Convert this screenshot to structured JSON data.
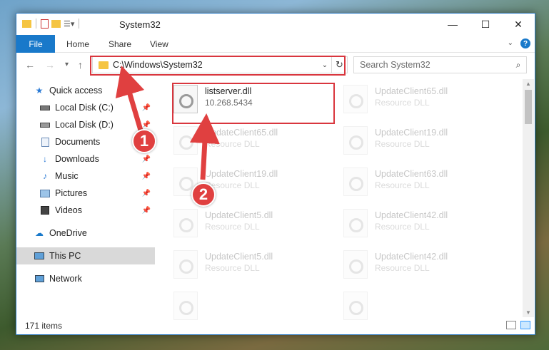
{
  "window": {
    "title": "System32",
    "controls": {
      "minimize": "—",
      "maximize": "☐",
      "close": "✕"
    }
  },
  "ribbon": {
    "tabs": [
      "File",
      "Home",
      "Share",
      "View"
    ]
  },
  "navigation": {
    "address": "C:\\Windows\\System32",
    "search_placeholder": "Search System32"
  },
  "sidebar": {
    "items": [
      {
        "label": "Quick access",
        "icon": "star-icon",
        "pinned": false
      },
      {
        "label": "Local Disk (C:)",
        "icon": "drive-icon",
        "pinned": true
      },
      {
        "label": "Local Disk (D:)",
        "icon": "drive-icon",
        "pinned": true
      },
      {
        "label": "Documents",
        "icon": "documents-icon",
        "pinned": true
      },
      {
        "label": "Downloads",
        "icon": "downloads-icon",
        "pinned": true
      },
      {
        "label": "Music",
        "icon": "music-icon",
        "pinned": true
      },
      {
        "label": "Pictures",
        "icon": "pictures-icon",
        "pinned": true
      },
      {
        "label": "Videos",
        "icon": "videos-icon",
        "pinned": true
      },
      {
        "label": "OneDrive",
        "icon": "onedrive-icon",
        "pinned": false
      },
      {
        "label": "This PC",
        "icon": "computer-icon",
        "pinned": false,
        "selected": true
      },
      {
        "label": "Network",
        "icon": "network-icon",
        "pinned": false
      }
    ]
  },
  "files": {
    "highlighted": {
      "name": "listserver.dll",
      "version": "10.268.5434"
    },
    "faded": [
      {
        "name": "UpdateClient65.dll",
        "type": "Resource DLL"
      },
      {
        "name": "UpdateClient65.dll",
        "type": "Resource DLL"
      },
      {
        "name": "UpdateClient19.dll",
        "type": "Resource DLL"
      },
      {
        "name": "UpdateClient19.dll",
        "type": "Resource DLL"
      },
      {
        "name": "UpdateClient63.dll",
        "type": "Resource DLL"
      },
      {
        "name": "UpdateClient5.dll",
        "type": "Resource DLL"
      },
      {
        "name": "UpdateClient42.dll",
        "type": "Resource DLL"
      },
      {
        "name": "UpdateClient5.dll",
        "type": "Resource DLL"
      },
      {
        "name": "UpdateClient42.dll",
        "type": "Resource DLL"
      }
    ]
  },
  "status": {
    "item_count": "171 items"
  },
  "annotations": {
    "step1": "1",
    "step2": "2"
  },
  "colors": {
    "accent": "#1979ca",
    "annotation": "#d9363e"
  }
}
